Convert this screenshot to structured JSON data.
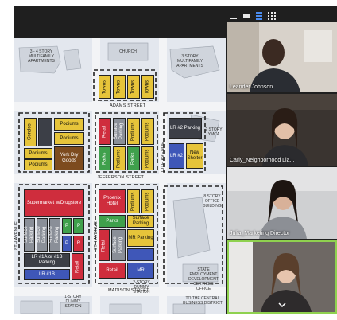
{
  "map": {
    "streets": {
      "adams": "ADAMS STREET",
      "jefferson": "JEFFERSON STREET",
      "madison": "MADISON STREET",
      "tenth": "10TH AVENUE",
      "ninth": "9TH AVENUE",
      "eighth": "8TH AVENUE"
    },
    "labels": {
      "multifamily": "3 - 4 STORY MULTIFAMILY APARTMENTS",
      "church": "CHURCH",
      "multifamily_right": "3 STORY MULTIFAMILY APARTMENTS",
      "ymca": "2 STORY YMCA",
      "office": "8 STORY OFFICE BUILDING",
      "state_office": "STATE EMPLOYMENT DEVELOPMENT SERVICES OFFICE",
      "central_district": "TO THE CENTRAL BUSINESS DISTRICT",
      "bottom_left": "1-STORY DUMMY STATION",
      "bottom_mid": "2-STORY DUMMY STATION"
    },
    "blocks": {
      "towns": "Towns",
      "condos": "Condos",
      "podiums": "Podiums",
      "york": "York Dry Goods",
      "retail": "Retail",
      "surface": "Surface Parking",
      "parks": "Parks",
      "lr2": "LR #2 Parking",
      "lr2b": "LR #2",
      "shelter": "New Shelter",
      "supermarket": "Supermarket w/Drugstore",
      "p": "P",
      "r": "R",
      "lr1": "LR #1A or #1B Parking",
      "lr1b": "LR #1B",
      "phoenix": "Phoenix Hotel",
      "mr_parking": "MR Parking",
      "mr": "MR"
    }
  },
  "participants": [
    {
      "name": "Leander Johnson"
    },
    {
      "name": "Carly_Neighborhood Lia..."
    },
    {
      "name": "Julia_Marketing Director"
    },
    {
      "name": ""
    }
  ],
  "toolbar": {
    "minimize_icon": "minimize-icon",
    "restore_icon": "restore-icon",
    "speaker_view_icon": "speaker-view-icon",
    "gallery_view_icon": "gallery-view-icon",
    "scroll_down": "chevron-down-icon"
  }
}
